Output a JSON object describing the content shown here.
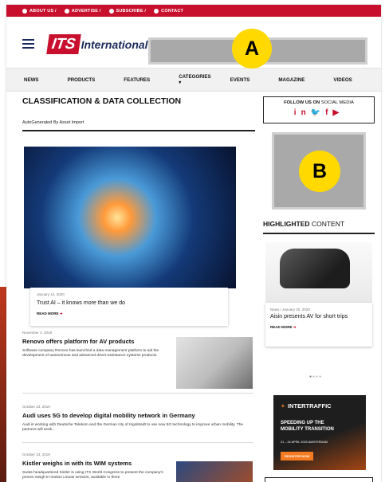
{
  "topbar": {
    "items": [
      {
        "label": "ABOUT US /",
        "icon": "info-icon"
      },
      {
        "label": "ADVERTISE /",
        "icon": "megaphone-icon"
      },
      {
        "label": "SUBSCRIBE /",
        "icon": "newspaper-icon"
      },
      {
        "label": "CONTACT",
        "icon": "user-icon"
      }
    ]
  },
  "header": {
    "logo_mark": "ITS",
    "logo_text": "International",
    "ad_a_label": "A"
  },
  "nav": {
    "items": [
      "NEWS",
      "PRODUCTS",
      "FEATURES",
      "CATEGORIES",
      "EVENTS",
      "MAGAZINE",
      "VIDEOS"
    ],
    "categories_caret": "▾",
    "search_icon": "⚲"
  },
  "main": {
    "section_title": "CLASSIFICATION & DATA COLLECTION",
    "autogen": "AutoGenerated By Asset Import",
    "featured": {
      "date": "January 14, 2020",
      "title": "Trust AI – it knows more than we do",
      "readmore": "READ MORE"
    },
    "articles": [
      {
        "date": "November 4, 2019",
        "title": "Renovo offers platform for AV products",
        "excerpt": "Software company Renovo has launched a data management platform to aid the development of autonomous and advanced driver-assistance systems products."
      },
      {
        "date": "October 23, 2019",
        "title": "Audi uses 5G to develop digital mobility network in Germany",
        "excerpt": "Audi is working with Deutsche Telekom and the German city of Ingolstadt to use new 5G technology to improve urban mobility. The partners will seek..."
      },
      {
        "date": "October 23, 2019",
        "title": "Kistler weighs in with its WIM systems",
        "excerpt": "Swiss-headquartered Kistler is using ITS World Congress to present the company's proven weigh-in-motion Lineas sensors, available in three"
      }
    ]
  },
  "sidebar": {
    "follow_prefix": "FOLLOW US ON",
    "follow_suffix": "SOCIAL MEDIA",
    "socials": [
      "in",
      "🐦",
      "f",
      "▶"
    ],
    "ad_b_label": "B",
    "highlighted_bold": "HIGHLIGHTED",
    "highlighted_rest": "CONTENT",
    "highlight": {
      "date": "News / January 20, 2020",
      "title": "Aisin presents AV for short trips",
      "readmore": "READ MORE"
    },
    "intertraffic": {
      "brand": "INTERTRAFFIC",
      "tagline_1": "SPEEDING UP THE",
      "tagline_2": "MOBILITY TRANSITION",
      "dates": "21 – 24 APRIL 2020 AMSTERDAM",
      "cta": "REGISTER NOW"
    }
  }
}
